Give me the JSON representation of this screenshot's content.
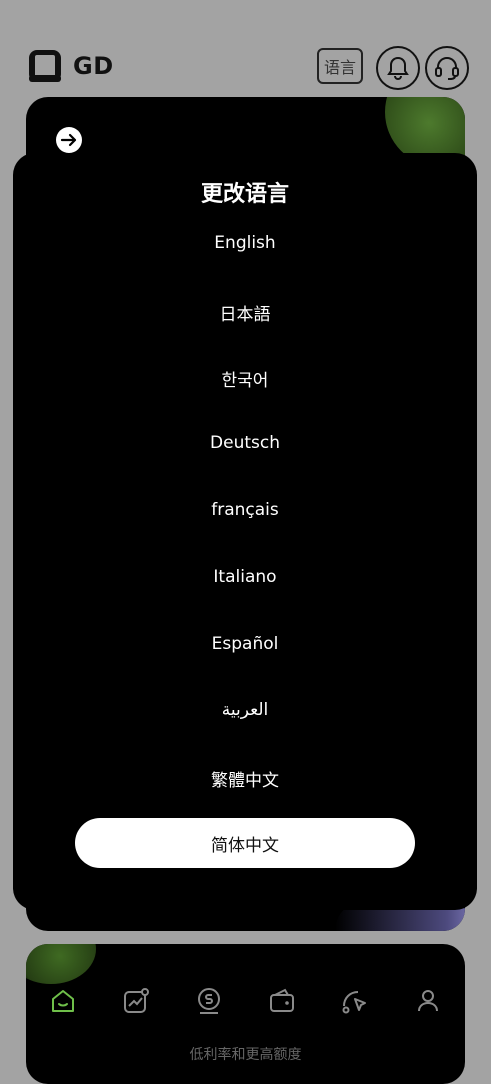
{
  "header": {
    "brand": "GD",
    "language_button_label": "语言"
  },
  "modal": {
    "title": "更改语言",
    "languages": [
      "English",
      "日本語",
      "한국어",
      "Deutsch",
      "français",
      "Italiano",
      "Español",
      "العربية",
      "繁體中文"
    ],
    "selected_language": "简体中文"
  },
  "bottom_nav": {
    "items": [
      "home-icon",
      "chart-icon",
      "coin-icon",
      "wallet-icon",
      "pointer-icon",
      "user-icon"
    ],
    "active_index": 0,
    "caption": "低利率和更高额度"
  },
  "colors": {
    "accent_green": "#6fbf4a",
    "icon_grey": "#8a8a8a",
    "background": "#a3a3a3"
  }
}
